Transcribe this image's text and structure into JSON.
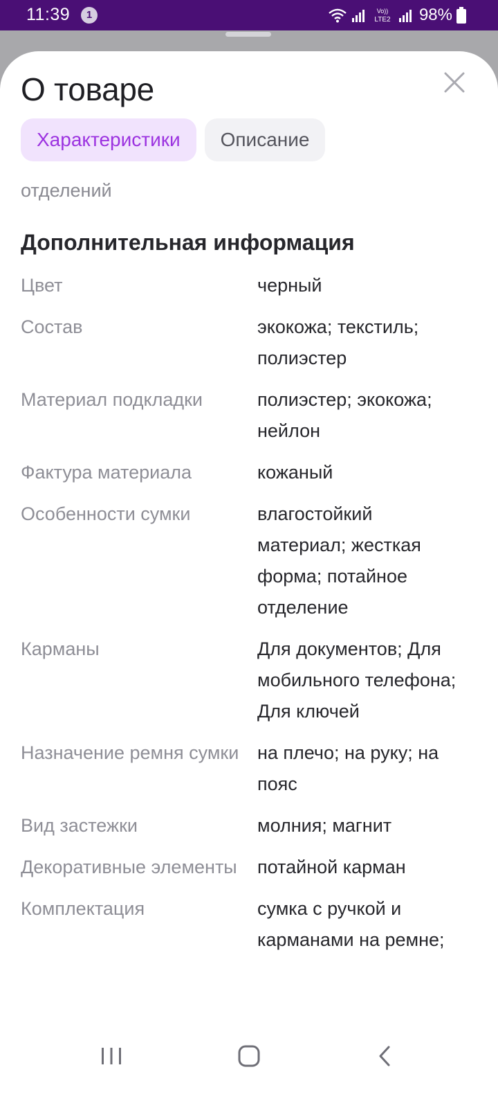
{
  "status_bar": {
    "time": "11:39",
    "notification_count": "1",
    "network_label": "Vo) LTE2",
    "battery": "98%"
  },
  "sheet": {
    "title": "О товаре",
    "close_icon": "close-icon"
  },
  "tabs": [
    {
      "label": "Характеристики",
      "active": true
    },
    {
      "label": "Описание",
      "active": false
    }
  ],
  "cut_text": "отделений",
  "section_title": "Дополнительная информация",
  "specs": [
    {
      "label": "Цвет",
      "value": "черный"
    },
    {
      "label": "Состав",
      "value": "экокожа; текстиль; полиэстер"
    },
    {
      "label": "Материал подкладки",
      "value": "полиэстер; экокожа; нейлон"
    },
    {
      "label": "Фактура материала",
      "value": "кожаный"
    },
    {
      "label": "Особенности сумки",
      "value": "влагостойкий материал; жесткая форма; потайное отделение"
    },
    {
      "label": "Карманы",
      "value": "Для документов; Для мобильного телефона; Для ключей"
    },
    {
      "label": "Назначение ремня сумки",
      "value": "на плечо; на руку; на пояс"
    },
    {
      "label": "Вид застежки",
      "value": "молния; магнит"
    },
    {
      "label": "Декоративные элементы",
      "value": "потайной карман"
    },
    {
      "label": "Комплектация",
      "value": "сумка с ручкой и карманами на ремне;"
    }
  ],
  "nav_bar": {
    "recent_icon": "recent-apps-icon",
    "home_icon": "home-icon",
    "back_icon": "back-icon"
  },
  "colors": {
    "status_bar": "#4a0f75",
    "accent": "#9c33e0",
    "tab_active_bg": "#f1e3fd",
    "tab_inactive_bg": "#f2f2f5",
    "overlay": "#a8a8ab"
  }
}
